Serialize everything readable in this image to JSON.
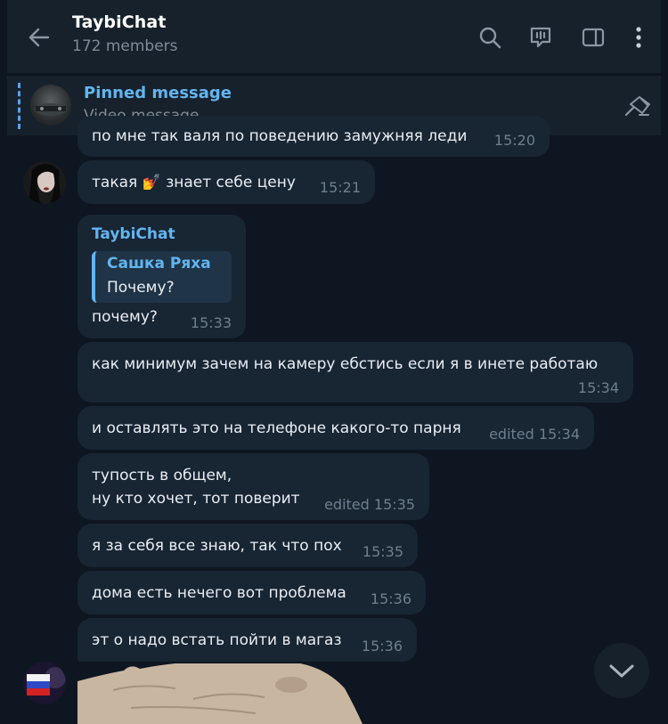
{
  "header": {
    "title": "TaybiChat",
    "subtitle": "172 members",
    "icons": [
      "back-arrow-icon",
      "search-icon",
      "video-chat-icon",
      "sidebar-icon",
      "more-icon"
    ]
  },
  "pinned": {
    "title": "Pinned message",
    "subtitle": "Video message",
    "icon": "unpin-icon"
  },
  "messages": [
    {
      "text": "по мне так валя по поведению замужняя леди",
      "time": "15:20"
    },
    {
      "text": "такая 💅 знает себе цену",
      "time": "15:21"
    },
    {
      "sender": "TaybiChat",
      "reply_name": "Сашка Ряха",
      "reply_text": "Почему?",
      "text": "почему?",
      "time": "15:33"
    },
    {
      "text": "как минимум зачем на камеру ебстись если я в инете работаю",
      "time": "15:34"
    },
    {
      "text": "и оставлять это на телефоне какого-то парня",
      "time": "edited 15:34"
    },
    {
      "text": "тупость в общем,\nну кто хочет, тот поверит",
      "time": "edited 15:35"
    },
    {
      "text": "я за себя все знаю, так что пох",
      "time": "15:35"
    },
    {
      "text": "дома есть нечего вот проблема",
      "time": "15:36"
    },
    {
      "text": "эт о надо встать пойти в магаз",
      "time": "15:36"
    }
  ],
  "colors": {
    "background": "#0e1621",
    "panel": "#17212b",
    "bubble": "#182533",
    "accent": "#62b5f0",
    "muted": "#6d7f8f"
  }
}
